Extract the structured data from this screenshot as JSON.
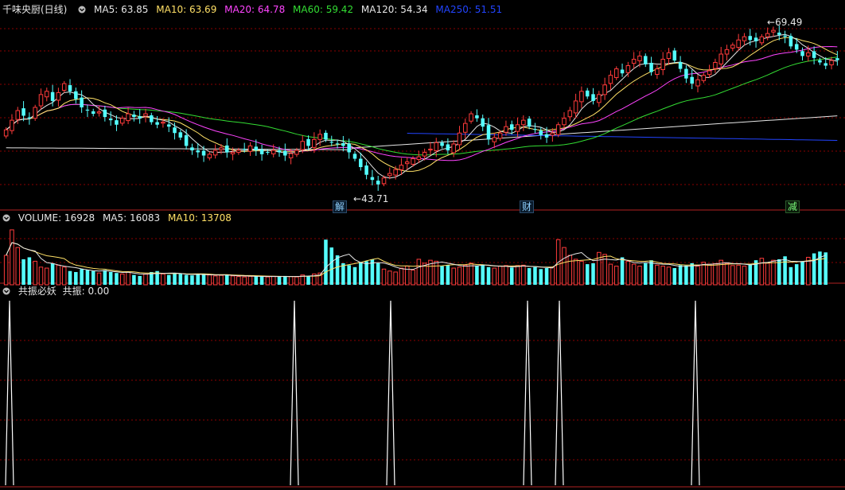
{
  "title": "千味央厨(日线)",
  "ma_legend": [
    {
      "label": "MA5: 63.85",
      "color": "#e6e6e6"
    },
    {
      "label": "MA10: 63.69",
      "color": "#ffe066"
    },
    {
      "label": "MA20: 64.78",
      "color": "#ff44ff"
    },
    {
      "label": "MA60: 59.42",
      "color": "#33dd33"
    },
    {
      "label": "MA120: 54.34",
      "color": "#e6e6e6"
    },
    {
      "label": "MA250: 51.51",
      "color": "#2244ff"
    }
  ],
  "price_high_label": "69.49",
  "price_low_label": "43.71",
  "event_tags": [
    {
      "text": "解",
      "color": "#8fd0ff"
    },
    {
      "text": "财",
      "color": "#8fd0ff"
    },
    {
      "text": "减",
      "color": "#7cff7c"
    }
  ],
  "volume_legend": [
    {
      "label": "VOLUME: 16928",
      "color": "#e6e6e6"
    },
    {
      "label": "MA5: 16083",
      "color": "#e6e6e6"
    },
    {
      "label": "MA10: 13708",
      "color": "#ffe066"
    }
  ],
  "indicator": {
    "name": "共振必妖",
    "value_label": "共振: 0.00"
  },
  "colors": {
    "up": "#ff3b3b",
    "down": "#54ffff",
    "grid": "#8b0000",
    "ma5": "#e6e6e6",
    "ma10": "#ffe066",
    "ma20": "#ff44ff",
    "ma60": "#33dd33",
    "ma120": "#e6e6e6",
    "ma250": "#2244ff"
  },
  "candles_close": [
    53.0,
    54.5,
    56.0,
    55.2,
    54.8,
    56.5,
    58.5,
    59.0,
    57.5,
    58.8,
    60.2,
    59.0,
    57.8,
    56.5,
    56.0,
    55.5,
    55.8,
    55.0,
    54.5,
    53.8,
    54.8,
    55.5,
    55.0,
    54.8,
    55.5,
    54.2,
    53.8,
    54.2,
    53.5,
    52.5,
    51.8,
    50.5,
    49.8,
    49.5,
    49.0,
    49.2,
    49.8,
    50.2,
    49.5,
    49.5,
    49.8,
    50.0,
    50.5,
    49.8,
    49.2,
    49.5,
    49.8,
    49.5,
    49.0,
    49.3,
    49.8,
    51.2,
    50.5,
    51.5,
    52.3,
    51.5,
    51.0,
    50.8,
    50.5,
    49.5,
    48.5,
    47.2,
    46.0,
    45.2,
    44.5,
    45.5,
    46.2,
    46.8,
    47.5,
    48.0,
    48.5,
    48.8,
    49.5,
    50.0,
    51.0,
    50.5,
    49.8,
    50.8,
    52.5,
    54.0,
    55.5,
    54.8,
    53.5,
    51.5,
    51.8,
    52.5,
    53.5,
    53.0,
    53.8,
    54.5,
    53.5,
    53.0,
    52.2,
    51.8,
    52.5,
    53.8,
    54.8,
    56.0,
    57.5,
    59.0,
    58.2,
    57.5,
    58.5,
    60.0,
    61.5,
    62.5,
    61.8,
    63.0,
    64.0,
    64.5,
    63.2,
    62.0,
    62.5,
    64.0,
    65.0,
    63.8,
    62.5,
    61.0,
    60.2,
    60.8,
    61.5,
    62.2,
    63.5,
    64.8,
    65.5,
    66.2,
    67.0,
    67.5,
    67.0,
    66.8,
    67.5,
    68.0,
    68.5,
    67.8,
    67.5,
    66.0,
    65.5,
    64.5,
    65.0,
    64.2,
    63.5,
    63.0,
    63.8,
    63.85
  ],
  "volumes": [
    15000,
    28000,
    19000,
    13000,
    14000,
    12000,
    9000,
    8500,
    11000,
    10000,
    9000,
    7000,
    6500,
    8000,
    7500,
    7000,
    6000,
    7500,
    6500,
    6000,
    5500,
    6500,
    5000,
    4500,
    5500,
    6500,
    7000,
    5500,
    5000,
    6000,
    5500,
    5000,
    4800,
    5200,
    5500,
    5000,
    4500,
    4800,
    5000,
    4500,
    4200,
    4000,
    4300,
    4500,
    4200,
    4000,
    4300,
    4100,
    4500,
    4200,
    4000,
    5000,
    4500,
    5500,
    6000,
    23000,
    19000,
    15000,
    11000,
    10000,
    9000,
    11500,
    12000,
    13000,
    11000,
    8000,
    7000,
    6500,
    8500,
    9500,
    7500,
    13000,
    11000,
    12500,
    12000,
    9500,
    10000,
    8500,
    9000,
    10000,
    11000,
    9800,
    10200,
    9000,
    8500,
    9500,
    9800,
    8800,
    9800,
    10000,
    8500,
    9000,
    8000,
    8500,
    9000,
    23000,
    19000,
    15000,
    13000,
    12000,
    10500,
    11000,
    16500,
    15500,
    10500,
    9500,
    14000,
    12000,
    10500,
    9500,
    11000,
    12500,
    10000,
    9500,
    9000,
    8500,
    10000,
    9800,
    11000,
    9500,
    11500,
    10500,
    10800,
    12500,
    10800,
    9800,
    10000,
    9500,
    10500,
    12500,
    13500,
    11000,
    12500,
    13000,
    14500,
    9000,
    10500,
    12000,
    14000,
    16000,
    16928,
    16500
  ]
}
